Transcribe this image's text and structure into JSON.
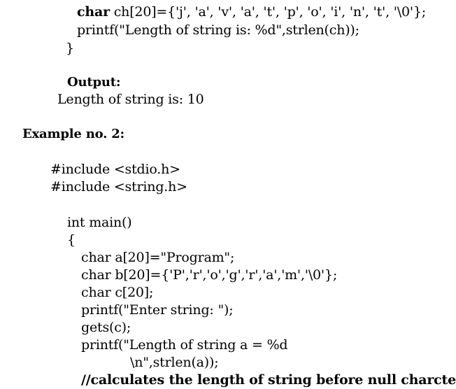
{
  "snippet_top": {
    "line1_keyword": "char",
    "line1_rest": " ch[20]={'j', 'a', 'v', 'a', 't', 'p', 'o', 'i', 'n', 't', '\\0'};",
    "line2": "printf(\"Length of string is: %d\",strlen(ch));",
    "closing_brace": "}"
  },
  "output": {
    "heading": "Output:",
    "text": "Length of string is: 10"
  },
  "example2": {
    "heading": "Example no. 2:",
    "include1": "#include <stdio.h>",
    "include2": "#include <string.h>",
    "main_decl": "int main()",
    "open_brace": "{",
    "body": [
      "char a[20]=\"Program\";",
      "char b[20]={'P','r','o','g','r','a','m','\\0'};",
      "char c[20];",
      "printf(\"Enter string: \");",
      "gets(c);",
      "printf(\"Length of string a = %d",
      "\\n\",strlen(a));"
    ],
    "comment": "//calculates the length of string before null charcter."
  }
}
